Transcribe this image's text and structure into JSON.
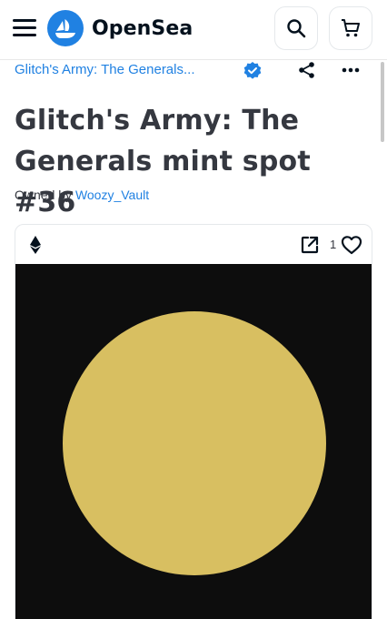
{
  "header": {
    "brand": "OpenSea",
    "brand_color": "#2081e2",
    "icons": [
      "menu-icon",
      "opensea-logo-icon",
      "search-icon",
      "cart-icon"
    ]
  },
  "collection": {
    "name": "Glitch's Army: The Generals...",
    "verified": true,
    "icons": [
      "verified-badge-icon",
      "share-icon",
      "more-icon"
    ]
  },
  "item": {
    "title": "Glitch's Army: The Generals mint spot #36",
    "owner_prefix": "Owned by",
    "owner_name": "Woozy_Vault"
  },
  "card": {
    "chain_icon": "ethereum-icon",
    "favorites_count": "1",
    "media_background": "#0d0d0d",
    "circle_color": "#d8bf61"
  }
}
